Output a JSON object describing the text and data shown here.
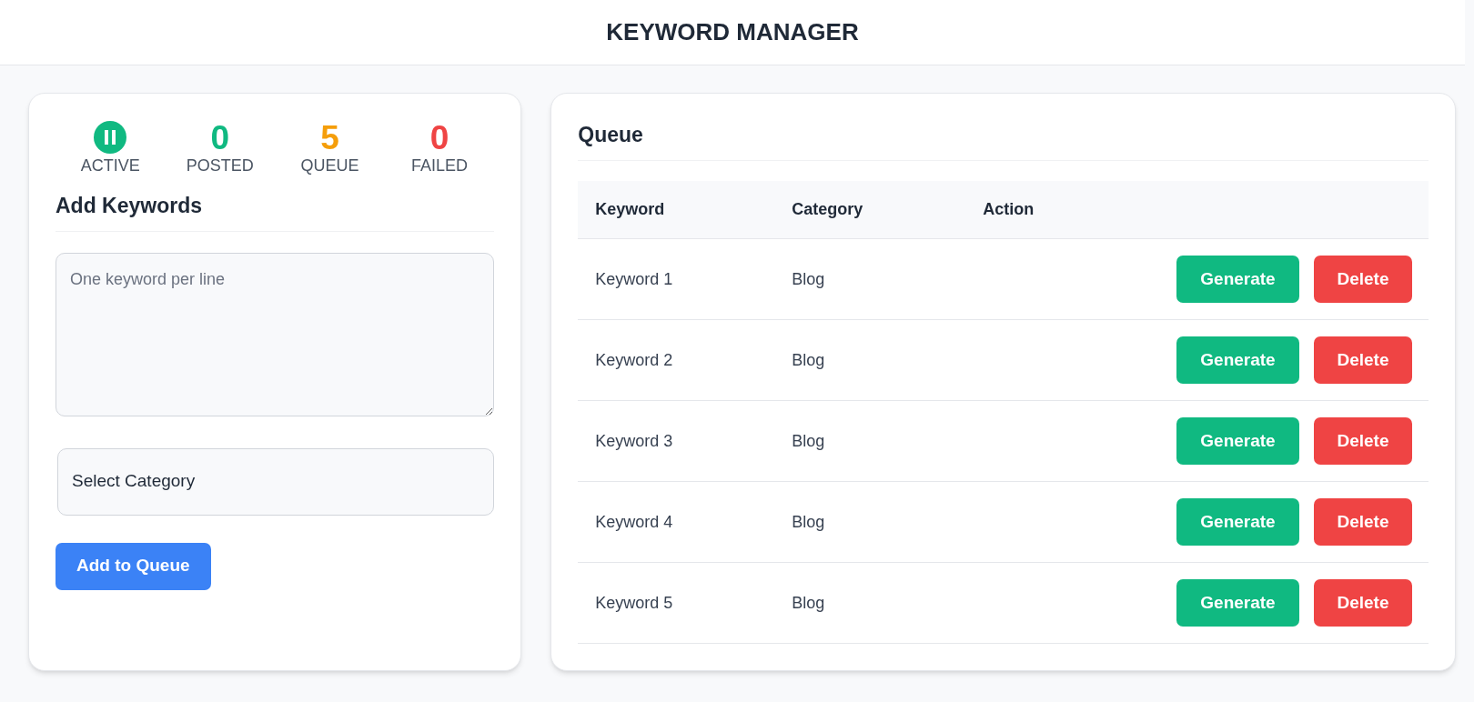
{
  "header": {
    "title": "KEYWORD MANAGER"
  },
  "stats": [
    {
      "kind": "icon",
      "label": "ACTIVE",
      "color": "#10b981"
    },
    {
      "kind": "number",
      "value": "0",
      "label": "POSTED",
      "color": "#10b981"
    },
    {
      "kind": "number",
      "value": "5",
      "label": "QUEUE",
      "color": "#f59e0b"
    },
    {
      "kind": "number",
      "value": "0",
      "label": "FAILED",
      "color": "#ef4444"
    }
  ],
  "add_keywords": {
    "title": "Add Keywords",
    "keywords_field": {
      "placeholder": "One keyword per line"
    },
    "category_select": {
      "value": "Select Category"
    },
    "submit_button": "Add to Queue"
  },
  "queue": {
    "title": "Queue",
    "columns": [
      "Keyword",
      "Category",
      "Action"
    ],
    "rows": [
      {
        "keyword": "Keyword 1",
        "category": "Blog",
        "actions": [
          "Generate",
          "Delete"
        ]
      },
      {
        "keyword": "Keyword 2",
        "category": "Blog",
        "actions": [
          "Generate",
          "Delete"
        ]
      },
      {
        "keyword": "Keyword 3",
        "category": "Blog",
        "actions": [
          "Generate",
          "Delete"
        ]
      },
      {
        "keyword": "Keyword 4",
        "category": "Blog",
        "actions": [
          "Generate",
          "Delete"
        ]
      },
      {
        "keyword": "Keyword 5",
        "category": "Blog",
        "actions": [
          "Generate",
          "Delete"
        ]
      }
    ]
  }
}
